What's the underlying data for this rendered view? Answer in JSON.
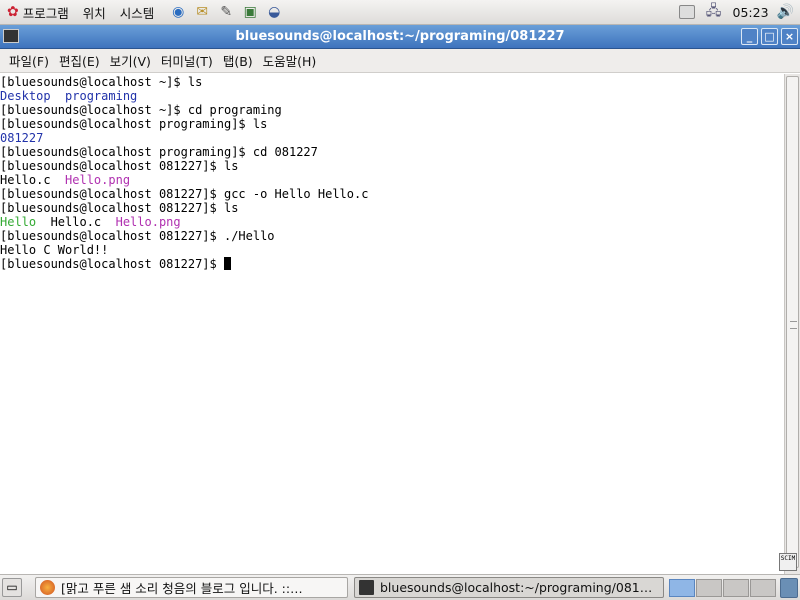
{
  "top_panel": {
    "menus": [
      "프로그램",
      "위치",
      "시스템"
    ],
    "launcher_icons": [
      "browser-icon",
      "mail-icon",
      "document-icon",
      "presentation-icon",
      "spreadsheet-icon"
    ],
    "clock": "05:23"
  },
  "window": {
    "title": "bluesounds@localhost:~/programing/081227",
    "buttons": {
      "minimize": "_",
      "maximize": "□",
      "close": "×"
    }
  },
  "menubar": [
    "파일(F)",
    "편집(E)",
    "보기(V)",
    "터미널(T)",
    "탭(B)",
    "도움말(H)"
  ],
  "terminal": {
    "lines": [
      [
        {
          "t": "[bluesounds@localhost ~]$ ls",
          "c": "plain"
        }
      ],
      [
        {
          "t": "Desktop",
          "c": "dir"
        },
        {
          "t": "  ",
          "c": "plain"
        },
        {
          "t": "programing",
          "c": "dir"
        }
      ],
      [
        {
          "t": "[bluesounds@localhost ~]$ cd programing",
          "c": "plain"
        }
      ],
      [
        {
          "t": "[bluesounds@localhost programing]$ ls",
          "c": "plain"
        }
      ],
      [
        {
          "t": "081227",
          "c": "dir"
        }
      ],
      [
        {
          "t": "[bluesounds@localhost programing]$ cd 081227",
          "c": "plain"
        }
      ],
      [
        {
          "t": "[bluesounds@localhost 081227]$ ls",
          "c": "plain"
        }
      ],
      [
        {
          "t": "Hello.c",
          "c": "plain"
        },
        {
          "t": "  ",
          "c": "plain"
        },
        {
          "t": "Hello.png",
          "c": "img"
        }
      ],
      [
        {
          "t": "[bluesounds@localhost 081227]$ gcc -o Hello Hello.c",
          "c": "plain"
        }
      ],
      [
        {
          "t": "[bluesounds@localhost 081227]$ ls",
          "c": "plain"
        }
      ],
      [
        {
          "t": "Hello",
          "c": "exe"
        },
        {
          "t": "  ",
          "c": "plain"
        },
        {
          "t": "Hello.c",
          "c": "plain"
        },
        {
          "t": "  ",
          "c": "plain"
        },
        {
          "t": "Hello.png",
          "c": "img"
        }
      ],
      [
        {
          "t": "[bluesounds@localhost 081227]$ ./Hello",
          "c": "plain"
        }
      ],
      [
        {
          "t": "Hello C World!!",
          "c": "plain"
        }
      ],
      [
        {
          "t": "[bluesounds@localhost 081227]$ ",
          "c": "plain"
        }
      ]
    ],
    "colors": {
      "dir": "#2233aa",
      "img": "#b030b0",
      "exe": "#33aa33"
    }
  },
  "im_indicator": "SCIM",
  "taskbar": {
    "tasks": [
      {
        "label": "[맑고 푸른 샘 소리 청음의 블로그 입니다. ::…",
        "icon": "firefox-icon"
      },
      {
        "label": "bluesounds@localhost:~/programing/081…",
        "icon": "terminal-icon"
      }
    ],
    "workspaces": 4
  }
}
